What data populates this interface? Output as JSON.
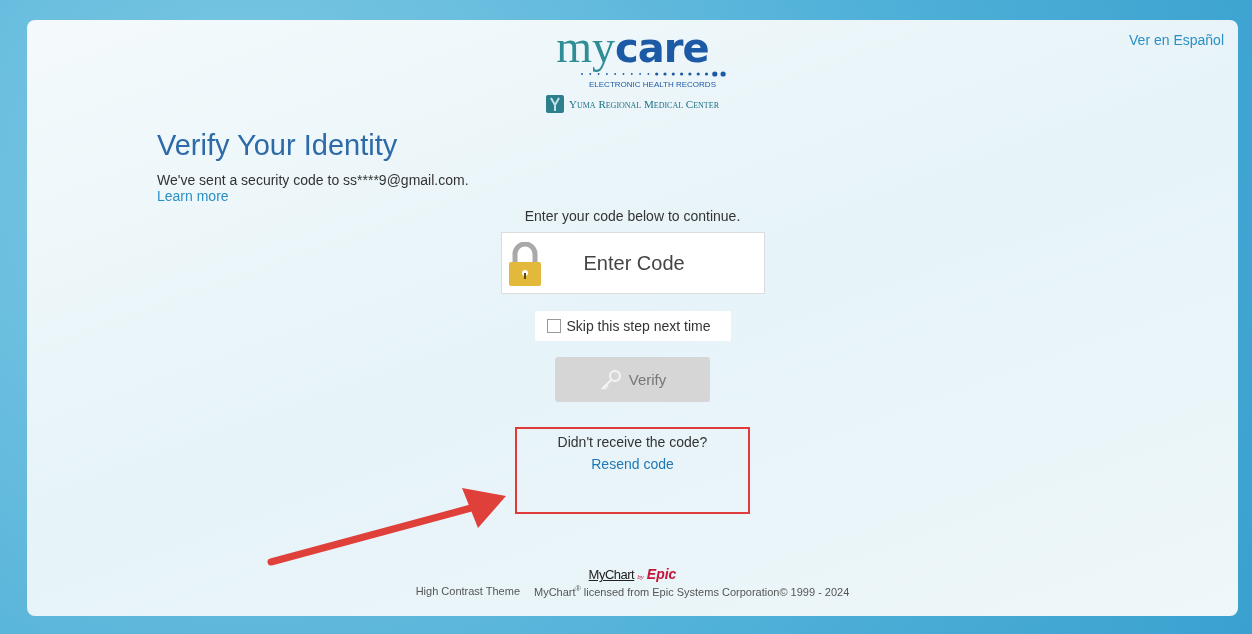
{
  "header": {
    "logo": {
      "brand_light": "my",
      "brand_bold": "care",
      "tagline": "ELECTRONIC HEALTH RECORDS",
      "organization": "Yuma Regional Medical Center"
    },
    "language_link": "Ver en Español"
  },
  "heading": "Verify Your Identity",
  "message": "We've sent a security code to ss****9@gmail.com.",
  "learn_more": "Learn more",
  "form": {
    "prompt": "Enter your code below to continue.",
    "code_field": {
      "placeholder": "Enter Code"
    },
    "skip_checkbox": {
      "label": "Skip this step next time",
      "checked": false
    },
    "verify_button": {
      "label": "Verify",
      "disabled": true
    },
    "resend_prompt": "Didn't receive the code?",
    "resend_link": "Resend code"
  },
  "footer": {
    "brand": {
      "name": "MyChart",
      "by": "by",
      "vendor": "Epic"
    },
    "links": [
      "High Contrast Theme"
    ],
    "copyright": "MyChart$^{®}$ licensed from Epic Systems Corporation© 1999 - 2024"
  }
}
